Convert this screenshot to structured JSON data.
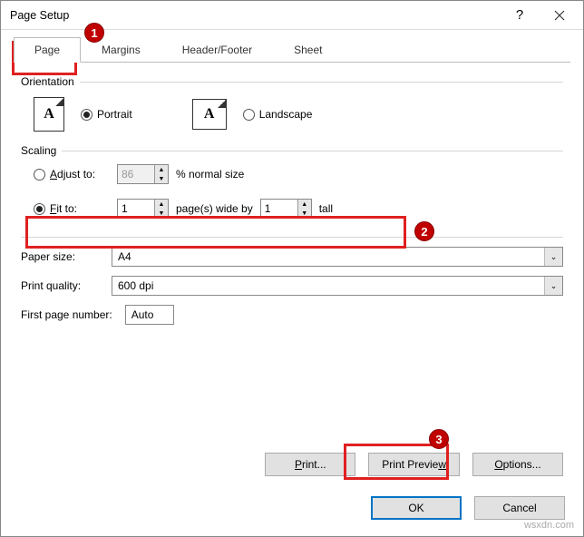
{
  "window": {
    "title": "Page Setup"
  },
  "tabs": {
    "page": "Page",
    "margins": "Margins",
    "header_footer": "Header/Footer",
    "sheet": "Sheet"
  },
  "orientation": {
    "section": "Orientation",
    "portrait": "Portrait",
    "landscape": "Landscape"
  },
  "scaling": {
    "section": "Scaling",
    "adjust_label": "Adjust to:",
    "adjust_value": "86",
    "adjust_suffix": "% normal size",
    "fit_label": "Fit to:",
    "fit_wide": "1",
    "fit_mid": "page(s) wide by",
    "fit_tall_val": "1",
    "fit_tall_suffix": "tall"
  },
  "paper": {
    "label": "Paper size:",
    "value": "A4"
  },
  "quality": {
    "label": "Print quality:",
    "value": "600 dpi"
  },
  "firstpage": {
    "label": "First page number:",
    "value": "Auto"
  },
  "buttons": {
    "print": "Print...",
    "preview": "Print Preview",
    "options": "Options...",
    "ok": "OK",
    "cancel": "Cancel"
  },
  "callouts": {
    "c1": "1",
    "c2": "2",
    "c3": "3"
  },
  "watermark": "wsxdn.com"
}
